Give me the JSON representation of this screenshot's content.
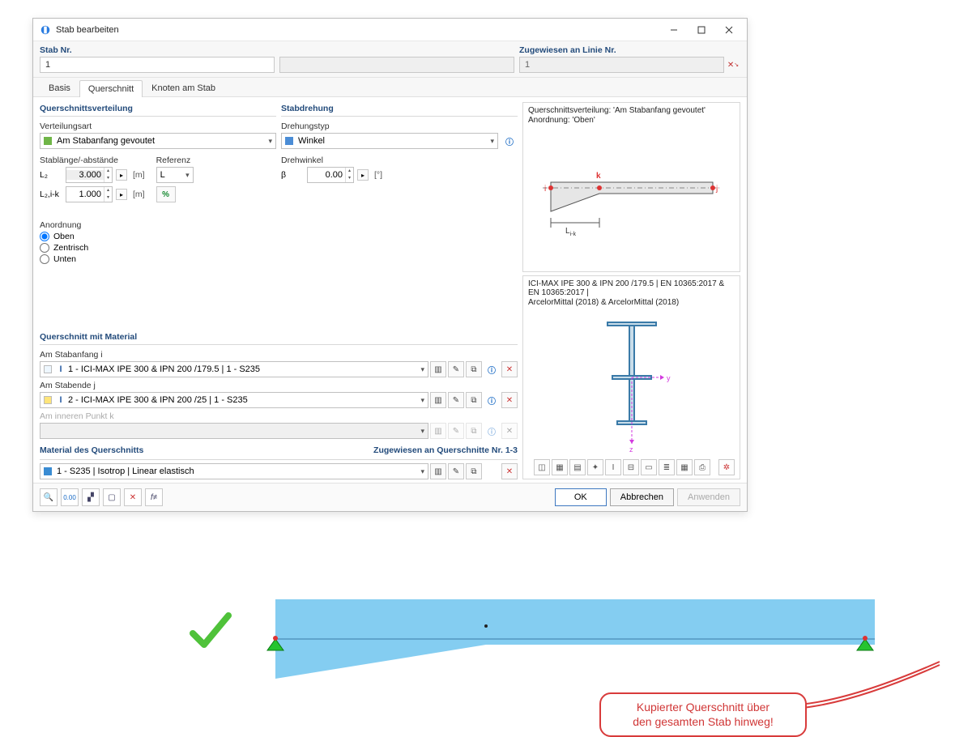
{
  "window": {
    "title": "Stab bearbeiten"
  },
  "top": {
    "stab_nr_label": "Stab Nr.",
    "stab_nr_value": "1",
    "linie_label": "Zugewiesen an Linie Nr.",
    "linie_value": "1"
  },
  "tabs": {
    "basis": "Basis",
    "querschnitt": "Querschnitt",
    "knoten": "Knoten am Stab"
  },
  "dist": {
    "header": "Querschnittsverteilung",
    "type_label": "Verteilungsart",
    "type_value": "Am Stabanfang gevoutet",
    "length_label": "Stablänge/-abstände",
    "ref_label": "Referenz",
    "lz_label": "L₂",
    "lz_value": "3.000",
    "lz_unit": "[m]",
    "lzik_label": "L₂,i-k",
    "lzik_value": "1.000",
    "lzik_unit": "[m]",
    "ref_value": "L",
    "anord_label": "Anordnung",
    "anord_oben": "Oben",
    "anord_zentrisch": "Zentrisch",
    "anord_unten": "Unten"
  },
  "rot": {
    "header": "Stabdrehung",
    "type_label": "Drehungstyp",
    "type_value": "Winkel",
    "angle_label": "Drehwinkel",
    "beta_label": "β",
    "beta_value": "0.00",
    "beta_unit": "[°]"
  },
  "cs": {
    "header": "Querschnitt mit Material",
    "start_label": "Am Stabanfang i",
    "start_value": "1 - ICI-MAX IPE 300 & IPN 200 /179.5 | 1 - S235",
    "end_label": "Am Stabende j",
    "end_value": "2 - ICI-MAX IPE 300 & IPN 200 /25 | 1 - S235",
    "inner_label": "Am inneren Punkt k",
    "mat_header": "Material des Querschnitts",
    "mat_assign": "Zugewiesen an Querschnitte Nr. 1-3",
    "mat_value": "1 - S235 | Isotrop | Linear elastisch"
  },
  "preview": {
    "line1": "Querschnittsverteilung: 'Am Stabanfang gevoutet'",
    "line2": "Anordnung: 'Oben'",
    "info_line1": "ICI-MAX IPE 300 & IPN 200 /179.5 | EN 10365:2017 & EN 10365:2017 |",
    "info_line2": "ArcelorMittal (2018) & ArcelorMittal (2018)",
    "k": "k",
    "i": "i",
    "j": "j",
    "lik": "L",
    "lik_sub": "i-k",
    "ax_y": "y",
    "ax_z": "z"
  },
  "buttons": {
    "ok": "OK",
    "cancel": "Abbrechen",
    "apply": "Anwenden"
  },
  "annot": {
    "text1": "Kupierter Querschnitt über",
    "text2": "den gesamten Stab hinweg!"
  }
}
